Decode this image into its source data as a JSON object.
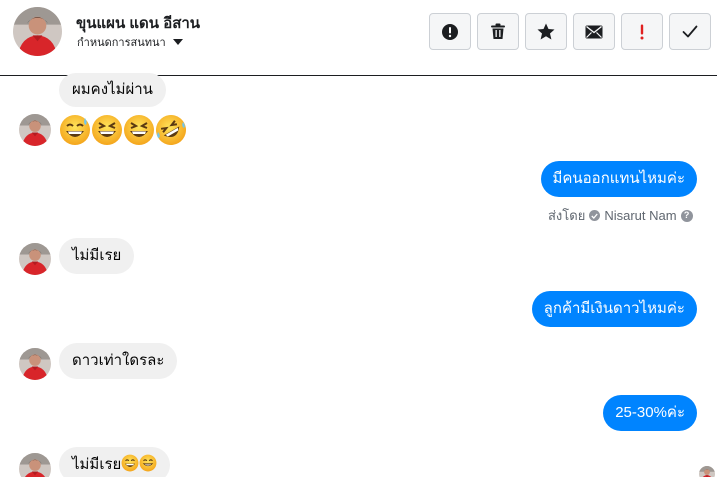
{
  "header": {
    "name": "ขุนแผน แดน อีสาน",
    "subtitle": "กำหนดการสนทนา"
  },
  "toolbar": {
    "buttons": [
      {
        "icon": "alert-circle-icon",
        "label": "report"
      },
      {
        "icon": "trash-icon",
        "label": "delete"
      },
      {
        "icon": "star-icon",
        "label": "star"
      },
      {
        "icon": "envelope-icon",
        "label": "mark unread"
      },
      {
        "icon": "exclamation-icon",
        "label": "spam"
      },
      {
        "icon": "checkmark-icon",
        "label": "done"
      }
    ]
  },
  "messages": [
    {
      "direction": "in",
      "text": "ผมคงไม่ผ่าน"
    },
    {
      "direction": "in",
      "type": "emoji",
      "emojis": [
        "grinning-sweat",
        "laughing",
        "laughing",
        "rolling-laughing"
      ]
    },
    {
      "direction": "out",
      "text": "มีคนออกแทนไหมค่ะ"
    },
    {
      "direction": "out",
      "text": "ลูกค้ามีเงินดาวไหมค่ะ"
    },
    {
      "direction": "in",
      "text": "ไม่มีเรย"
    },
    {
      "direction": "in",
      "text": "ดาวเท่าใดรละ"
    },
    {
      "direction": "out",
      "text": "25-30%ค่ะ"
    },
    {
      "direction": "in",
      "text": "ไม่มีเรย",
      "emojis": [
        "grinning-sweat",
        "beaming"
      ]
    }
  ],
  "sent_by": {
    "prefix": "ส่งโดย",
    "name": "Nisarut Nam"
  },
  "colors": {
    "outgoing_bubble": "#0084ff",
    "incoming_bubble": "#f0f0f0",
    "spam_icon": "#e02020"
  }
}
